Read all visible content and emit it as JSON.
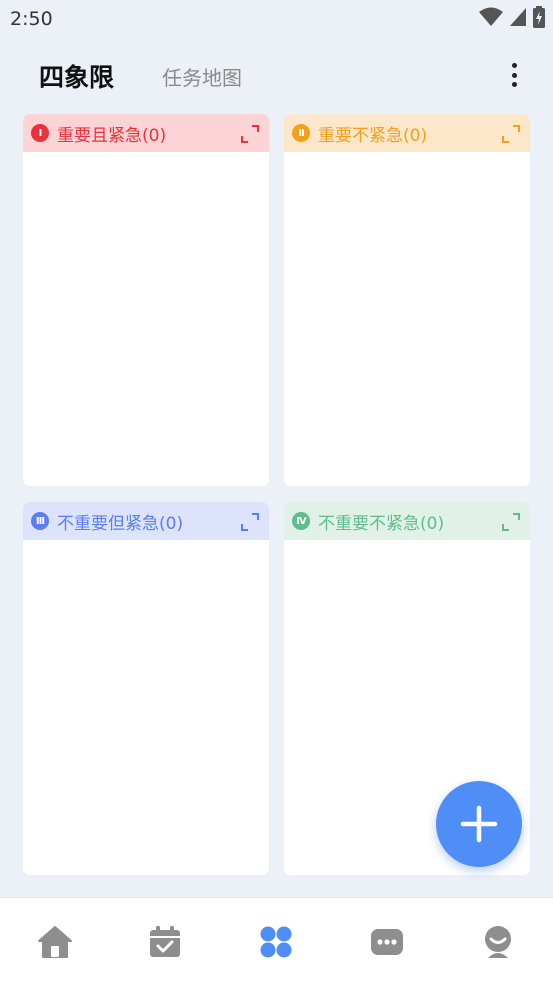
{
  "status_bar": {
    "time": "2:50"
  },
  "header": {
    "tabs": [
      {
        "label": "四象限",
        "active": true
      },
      {
        "label": "任务地图",
        "active": false
      }
    ]
  },
  "quadrants": [
    {
      "badge": "I",
      "title": "重要且紧急(0)",
      "color": "#e8323c",
      "header_bg": "#fdd4d6"
    },
    {
      "badge": "II",
      "title": "重要不紧急(0)",
      "color": "#f2a11d",
      "header_bg": "#fde7cb"
    },
    {
      "badge": "III",
      "title": "不重要但紧急(0)",
      "color": "#5b7ff0",
      "header_bg": "#dde3fb"
    },
    {
      "badge": "IV",
      "title": "不重要不紧急(0)",
      "color": "#5fbd8b",
      "header_bg": "#e1f1e8"
    }
  ],
  "bottom_nav": {
    "items": [
      {
        "icon": "home-icon",
        "active": false
      },
      {
        "icon": "calendar-check-icon",
        "active": false
      },
      {
        "icon": "quadrant-grid-icon",
        "active": true
      },
      {
        "icon": "chat-bubble-icon",
        "active": false
      },
      {
        "icon": "profile-icon",
        "active": false
      }
    ]
  },
  "colors": {
    "accent": "#4f8ef7",
    "nav_inactive": "#8e8e8e",
    "background": "#ecf0f7"
  }
}
